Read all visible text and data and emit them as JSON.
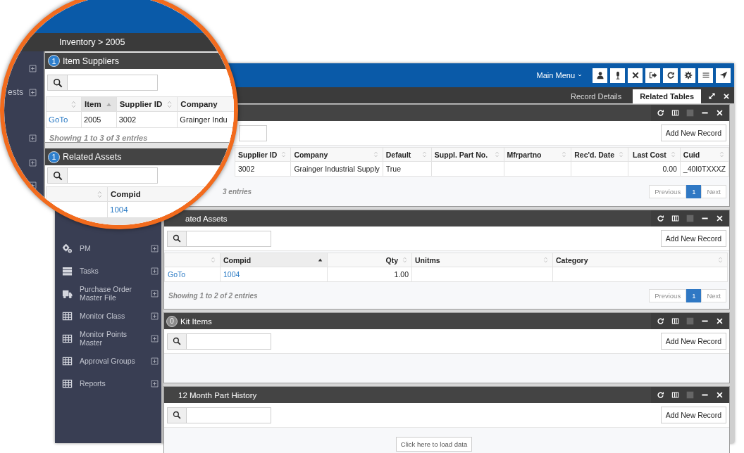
{
  "top_bar": {
    "menu_label": "Main Menu"
  },
  "tabs": [
    {
      "label": "Record Details",
      "selected": false
    },
    {
      "label": "Related Tables",
      "selected": true
    }
  ],
  "sidebar": {
    "items": [
      {
        "label": "PM",
        "kind": "gears"
      },
      {
        "label": "Tasks",
        "kind": "tasks"
      },
      {
        "label": "Purchase Order Master File",
        "kind": "truck"
      },
      {
        "label": "Monitor Class",
        "kind": "grid"
      },
      {
        "label": "Monitor Points Master",
        "kind": "grid"
      },
      {
        "label": "Approval Groups",
        "kind": "grid"
      },
      {
        "label": "Reports",
        "kind": "grid"
      }
    ]
  },
  "panels": [
    {
      "kind": "table",
      "add_button": "Add New Record",
      "columns": [
        {
          "label": "Supplier ID",
          "kind": "text",
          "sorted": false
        },
        {
          "label": "Company",
          "kind": "text",
          "sorted": false
        },
        {
          "label": "Default",
          "kind": "text",
          "sorted": false
        },
        {
          "label": "Suppl. Part No.",
          "kind": "text",
          "sorted": false
        },
        {
          "label": "Mfrpartno",
          "kind": "text",
          "sorted": false
        },
        {
          "label": "Rec'd. Date",
          "kind": "text",
          "sorted": false
        },
        {
          "label": "Last Cost",
          "kind": "number",
          "sorted": false
        },
        {
          "label": "Cuid",
          "kind": "text",
          "sorted": false
        }
      ],
      "rows": [
        [
          "3002",
          "Grainger Industrial Supply",
          "True",
          null,
          null,
          null,
          "0.00",
          "_40I0TXXXZ"
        ]
      ],
      "footer": "3 entries",
      "pager": {
        "previous": {
          "label": "Previous",
          "disabled": true
        },
        "pages": [
          {
            "label": "1",
            "selected": true
          }
        ],
        "next": {
          "label": "Next",
          "disabled": true
        }
      }
    },
    {
      "kind": "table",
      "title": "ated Assets",
      "add_button": "Add New Record",
      "columns": [
        {
          "kind": "link",
          "sorted": false
        },
        {
          "label": "Compid",
          "kind": "link",
          "sorted": true
        },
        {
          "label": "Qty",
          "kind": "number",
          "sorted": false
        },
        {
          "label": "Unitms",
          "kind": "text",
          "sorted": false
        },
        {
          "label": "Category",
          "kind": "text",
          "sorted": false
        }
      ],
      "rows": [
        [
          "GoTo",
          "1004",
          "1.00",
          null,
          null
        ]
      ],
      "footer": "Showing 1 to 2 of 2 entries",
      "pager": {
        "previous": {
          "label": "Previous",
          "disabled": true
        },
        "pages": [
          {
            "label": "1",
            "selected": true
          }
        ],
        "next": {
          "label": "Next",
          "disabled": true
        }
      }
    },
    {
      "kind": "empty",
      "badge": {
        "text": "0",
        "color": "#8c8c8c"
      },
      "title": "Kit Items",
      "add_button": "Add New Record"
    },
    {
      "kind": "load",
      "title": "12 Month Part History",
      "add_button": "Add New Record",
      "load_button": "Click here to load data"
    }
  ],
  "magnifier": {
    "breadcrumb": "Inventory > 2005",
    "sidebar_label": "ests",
    "panels": [
      {
        "badge": {
          "text": "1",
          "color": "#2e7fcd"
        },
        "title": "Item Suppliers",
        "columns": [
          {
            "kind": "link",
            "sorted": false
          },
          {
            "label": "Item",
            "kind": "text",
            "sorted": true
          },
          {
            "label": "Supplier ID",
            "kind": "text",
            "sorted": false
          },
          {
            "label": "Company",
            "kind": "text"
          }
        ],
        "rows": [
          [
            "GoTo",
            "2005",
            "3002",
            "Grainger Indu"
          ]
        ],
        "footer": "Showing 1 to 3 of 3 entries"
      },
      {
        "badge": {
          "text": "1",
          "color": "#2e7fcd"
        },
        "title": "Related Assets",
        "columns": [
          {
            "sorted": false
          },
          {
            "label": "Compid",
            "kind": "link"
          }
        ],
        "rows": [
          [
            null,
            "1004"
          ]
        ]
      }
    ]
  }
}
